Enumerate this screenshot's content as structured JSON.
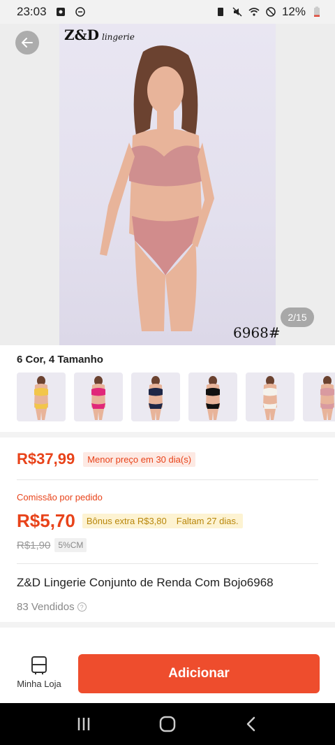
{
  "status_bar": {
    "time": "23:03",
    "battery": "12%"
  },
  "hero": {
    "brand": "Z&D",
    "brand_sub": "lingerie",
    "model_code": "6968#",
    "page_counter": "2/15"
  },
  "variants": {
    "title": "6 Cor, 4 Tamanho",
    "thumbnails": [
      {
        "color": "#f2c64a"
      },
      {
        "color": "#e0287a"
      },
      {
        "color": "#1e2747"
      },
      {
        "color": "#111111"
      },
      {
        "color": "#f4f2ec"
      },
      {
        "color": "#d99aa0"
      }
    ]
  },
  "price": {
    "current": "R$37,99",
    "lowest_badge": "Menor preço em 30 dia(s)"
  },
  "commission": {
    "label": "Comissão por pedido",
    "value": "R$5,70",
    "bonus": "Bônus extra R$3,80",
    "remaining": "Faltam 27 dias.",
    "old_value": "R$1,90",
    "rate": "5%CM"
  },
  "product": {
    "title": "Z&D Lingerie Conjunto de Renda Com Bojo6968",
    "sold": "83 Vendidos"
  },
  "bottom_bar": {
    "store_label": "Minha Loja",
    "add_label": "Adicionar"
  },
  "colors": {
    "accent": "#ee4d2d",
    "price": "#e8431a"
  }
}
